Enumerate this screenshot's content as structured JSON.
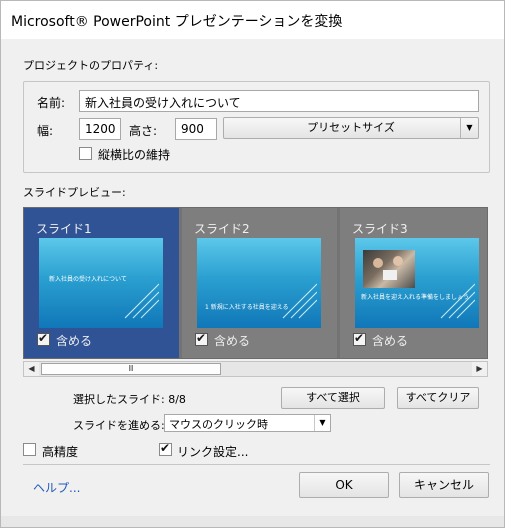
{
  "window": {
    "title": "Microsoft® PowerPoint プレゼンテーションを変換"
  },
  "project": {
    "section_label": "プロジェクトのプロパティ:",
    "name_label": "名前:",
    "name_value": "新入社員の受け入れについて",
    "width_label": "幅:",
    "width_value": "1200",
    "height_label": "高さ:",
    "height_value": "900",
    "preset_label": "プリセットサイズ",
    "aspect_label": "縦横比の維持",
    "aspect_checked": false
  },
  "preview": {
    "section_label": "スライドプレビュー:",
    "slides": [
      {
        "label": "スライド1",
        "include_label": "含める",
        "included": true,
        "thumb_text": "新入社員の受け入れについて"
      },
      {
        "label": "スライド2",
        "include_label": "含める",
        "included": true,
        "thumb_text": "1  新規に入社する社員を迎える"
      },
      {
        "label": "スライド3",
        "include_label": "含める",
        "included": true,
        "thumb_text": "新入社員を迎え入れる準備をしましょう"
      }
    ],
    "scroll_thumb_grip": "Ⅲ"
  },
  "selection": {
    "selected_label": "選択したスライド: 8/8",
    "select_all": "すべて選択",
    "clear_all": "すべてクリア",
    "advance_label": "スライドを進める:",
    "advance_value": "マウスのクリック時"
  },
  "options": {
    "high_quality_label": "高精度",
    "high_quality_checked": false,
    "link_settings_label": "リンク設定...",
    "link_settings_checked": true
  },
  "footer": {
    "help": "ヘルプ...",
    "ok": "OK",
    "cancel": "キャンセル"
  },
  "colors": {
    "selected_slide_bg": "#2f5395",
    "slide_bg": "#7e7e7e",
    "link": "#1e5bb8"
  }
}
